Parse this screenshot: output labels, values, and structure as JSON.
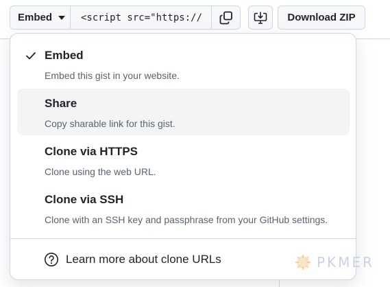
{
  "toolbar": {
    "embed_label": "Embed",
    "embed_input_value": "<script src=\"https://",
    "download_zip_label": "Download ZIP"
  },
  "menu": {
    "items": [
      {
        "title": "Embed",
        "desc": "Embed this gist in your website.",
        "selected": true
      },
      {
        "title": "Share",
        "desc": "Copy sharable link for this gist.",
        "selected": false
      },
      {
        "title": "Clone via HTTPS",
        "desc": "Clone using the web URL.",
        "selected": false
      },
      {
        "title": "Clone via SSH",
        "desc": "Clone with an SSH key and passphrase from your GitHub settings.",
        "selected": false
      }
    ],
    "learn_more_label": "Learn more about clone URLs"
  },
  "watermark": {
    "text": "PKMER"
  },
  "icons": {
    "caret": "triangle-down-icon",
    "copy": "copy-icon",
    "desktop": "desktop-download-icon",
    "check": "check-icon",
    "help": "question-circle-icon"
  },
  "colors": {
    "border": "#d0d7de",
    "button_bg": "#f6f8fa",
    "hover_bg": "#f3f4f6",
    "text": "#1f2328",
    "muted": "#59636e"
  }
}
